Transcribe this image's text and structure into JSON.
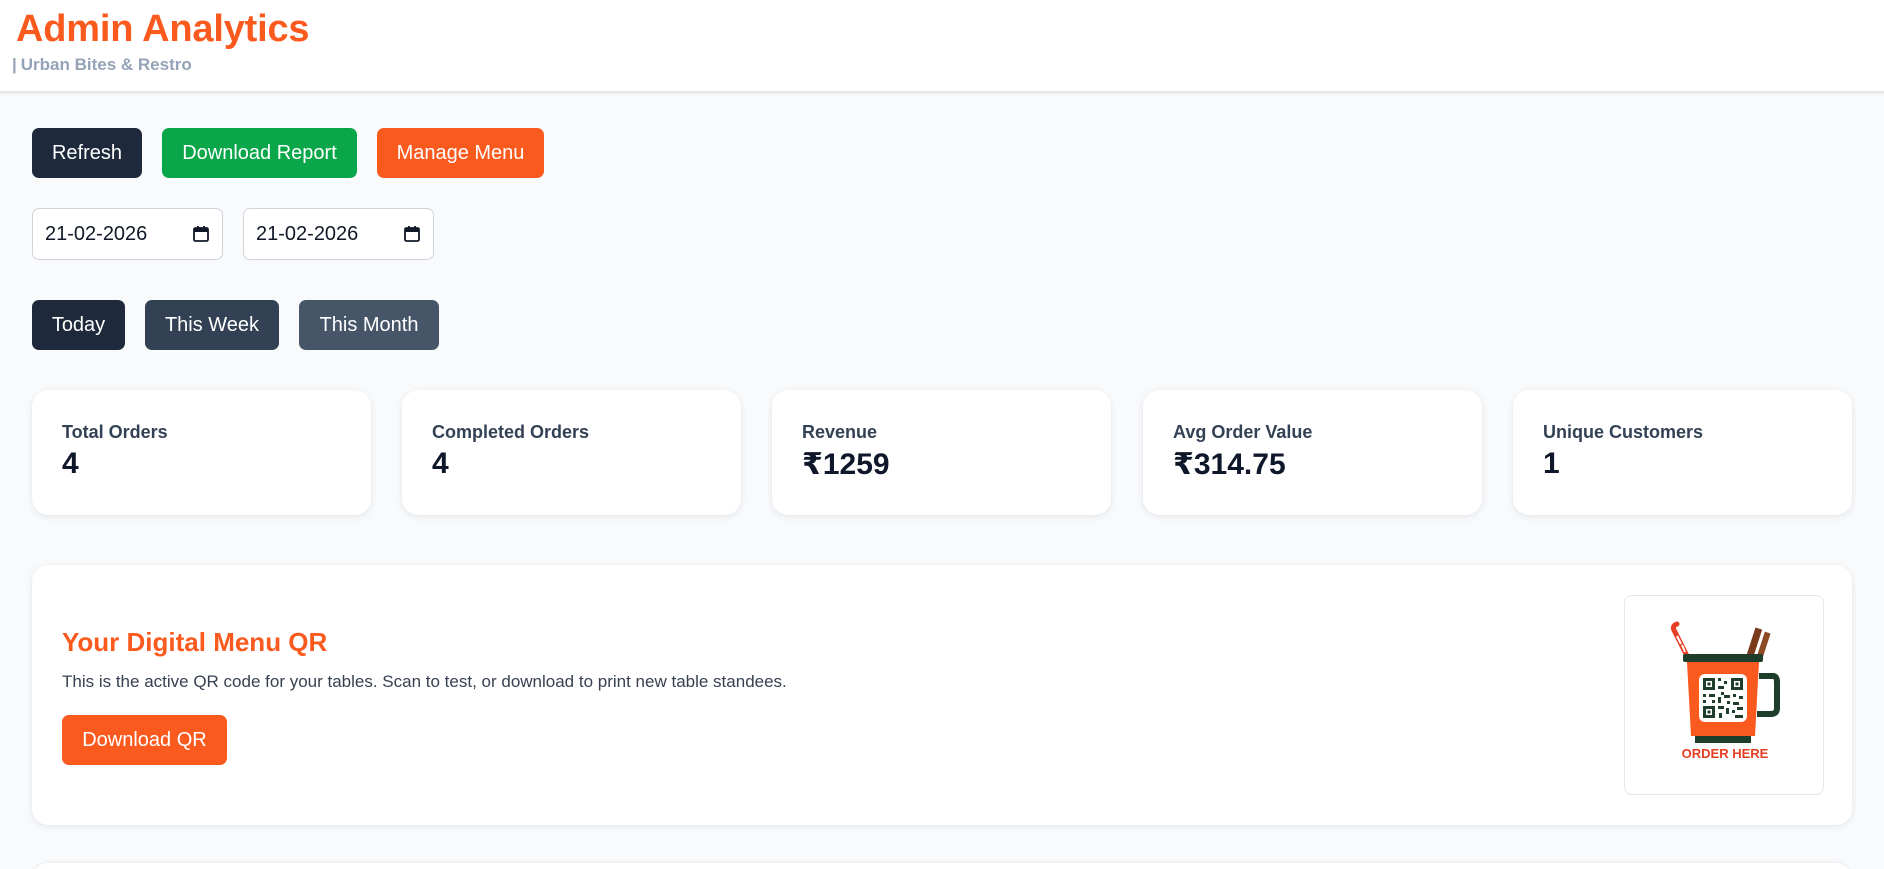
{
  "header": {
    "title": "Admin Analytics",
    "subtitle_separator": "|",
    "subtitle": "Urban Bites & Restro"
  },
  "actions": {
    "refresh_label": "Refresh",
    "download_report_label": "Download Report",
    "manage_menu_label": "Manage Menu"
  },
  "date_range": {
    "from": "21-02-2026",
    "to": "21-02-2026"
  },
  "periods": {
    "today": "Today",
    "week": "This Week",
    "month": "This Month"
  },
  "stats": [
    {
      "label": "Total Orders",
      "value": "4"
    },
    {
      "label": "Completed Orders",
      "value": "4"
    },
    {
      "label": "Revenue",
      "value": "₹1259"
    },
    {
      "label": "Avg Order Value",
      "value": "₹314.75"
    },
    {
      "label": "Unique Customers",
      "value": "1"
    }
  ],
  "qr": {
    "title": "Your Digital Menu QR",
    "description": "This is the active QR code for your tables. Scan to test, or download to print new table standees.",
    "download_label": "Download QR",
    "image_caption": "ORDER HERE"
  },
  "colors": {
    "brand": "#fb5a1e",
    "dark": "#1e293b",
    "success": "#0aa64a"
  }
}
